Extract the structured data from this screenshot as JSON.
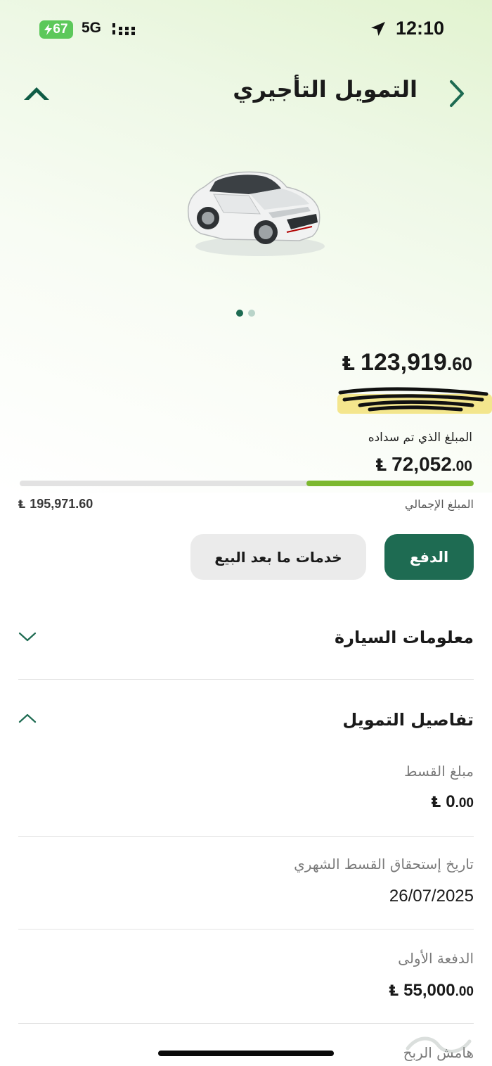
{
  "status_bar": {
    "battery": "67",
    "network": "5G",
    "time": "12:10"
  },
  "header": {
    "title": "التمويل التأجيري"
  },
  "carousel": {
    "image": "white-sedan-car",
    "active_index": 0,
    "count": 2
  },
  "summary": {
    "remaining_int": "123,919",
    "remaining_dec": ".60",
    "paid_label": "المبلغ الذي تم سداده",
    "paid_int": "72,052",
    "paid_dec": ".00",
    "paid_fraction": 0.3677,
    "total_label": "المبلغ الإجمالي",
    "total_amount": "195,971.60",
    "currency_symbol": "⃁"
  },
  "actions": {
    "pay_label": "الدفع",
    "after_sales_label": "خدمات ما بعد البيع"
  },
  "sections": {
    "car_info": "معلومات السيارة",
    "finance_details": "تفاصيل التمويل"
  },
  "finance_details": {
    "installment_label": "مبلغ القسط",
    "installment_int": "0",
    "installment_dec": ".00",
    "due_date_label": "تاريخ إستحقاق القسط الشهري",
    "due_date_value": "26/07/2025",
    "down_payment_label": "الدفعة الأولى",
    "down_payment_int": "55,000",
    "down_payment_dec": ".00",
    "profit_margin_label": "هامش الربح"
  },
  "colors": {
    "primary": "#1e6b52",
    "progress": "#7cb82f",
    "battery": "#5cc85a"
  }
}
